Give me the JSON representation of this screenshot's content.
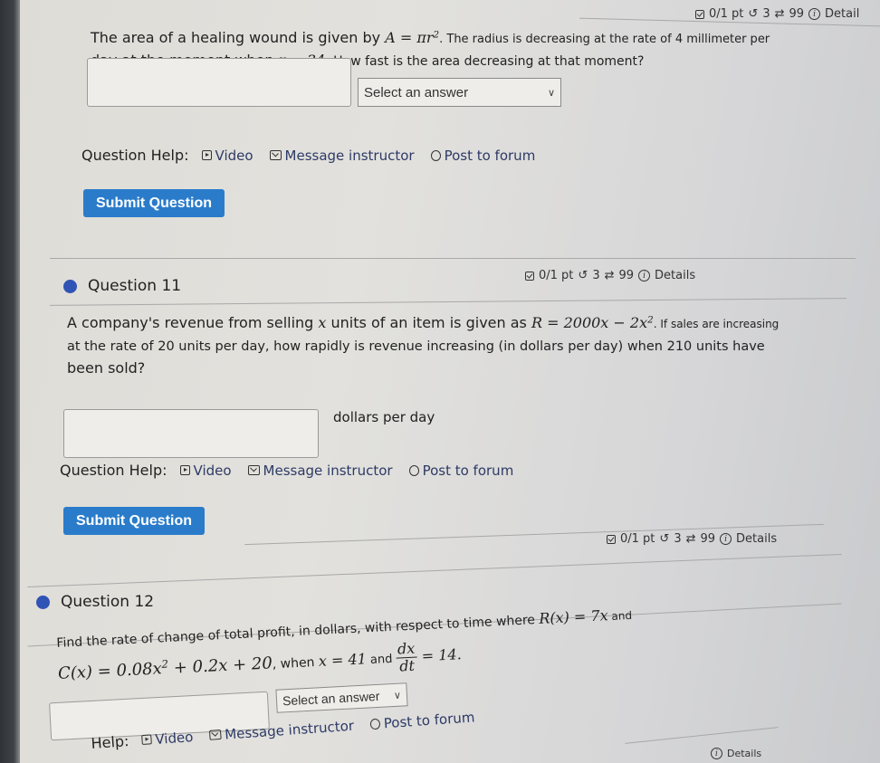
{
  "top_question": {
    "score": {
      "points": "0/1 pt",
      "retries": "3",
      "attempts": "99",
      "details": "Detail"
    },
    "text_prefix": "The area of a healing wound is given by ",
    "formula_A": "A = πr",
    "formula_A_exp": "2",
    "text_mid": ". The radius is decreasing at the rate of 4 millimeter per",
    "text_line2_prefix": "day at the moment when ",
    "formula_r": "r = 34",
    "text_line2_suffix": ". How fast is the area decreasing at that moment?",
    "answer_value": "",
    "select_value": "Select an answer",
    "help": {
      "label": "Question Help:",
      "video": "Video",
      "message": "Message instructor",
      "forum": "Post to forum"
    },
    "submit_label": "Submit Question"
  },
  "question11": {
    "title": "Question 11",
    "score": {
      "points": "0/1 pt",
      "retries": "3",
      "attempts": "99",
      "details": "Details"
    },
    "text_prefix": "A company's revenue from selling ",
    "var_x": "x",
    "text_mid": " units of an item is given as ",
    "formula_R": "R = 2000x − 2x",
    "formula_R_exp": "2",
    "text_after_formula": ". If sales are increasing",
    "text_line2": "at the rate of 20 units per day, how rapidly is revenue increasing (in dollars per day) when 210 units have",
    "text_line3": "been sold?",
    "answer_value": "",
    "unit_label": "dollars per day",
    "help": {
      "label": "Question Help:",
      "video": "Video",
      "message": "Message instructor",
      "forum": "Post to forum"
    },
    "submit_label": "Submit Question"
  },
  "question12": {
    "title": "Question 12",
    "score": {
      "points": "0/1 pt",
      "retries": "3",
      "attempts": "99",
      "details": "Details"
    },
    "text_prefix": "Find the rate of change of total profit, in dollars, with respect to time where ",
    "formula_Rx": "R(x) = 7x",
    "text_and": " and",
    "formula_Cx": "C(x) = 0.08x",
    "formula_Cx_exp": "2",
    "formula_Cx_rest": " + 0.2x + 20",
    "text_when": ", when ",
    "formula_x": "x = 41",
    "text_and2": " and ",
    "frac_num": "dx",
    "frac_den": "dt",
    "frac_rhs": " = 14.",
    "answer_value": "",
    "select_value": "Select an answer",
    "help": {
      "label": "Help:",
      "video": "Video",
      "message": "Message instructor",
      "forum": "Post to forum"
    },
    "next_details": "Details"
  }
}
